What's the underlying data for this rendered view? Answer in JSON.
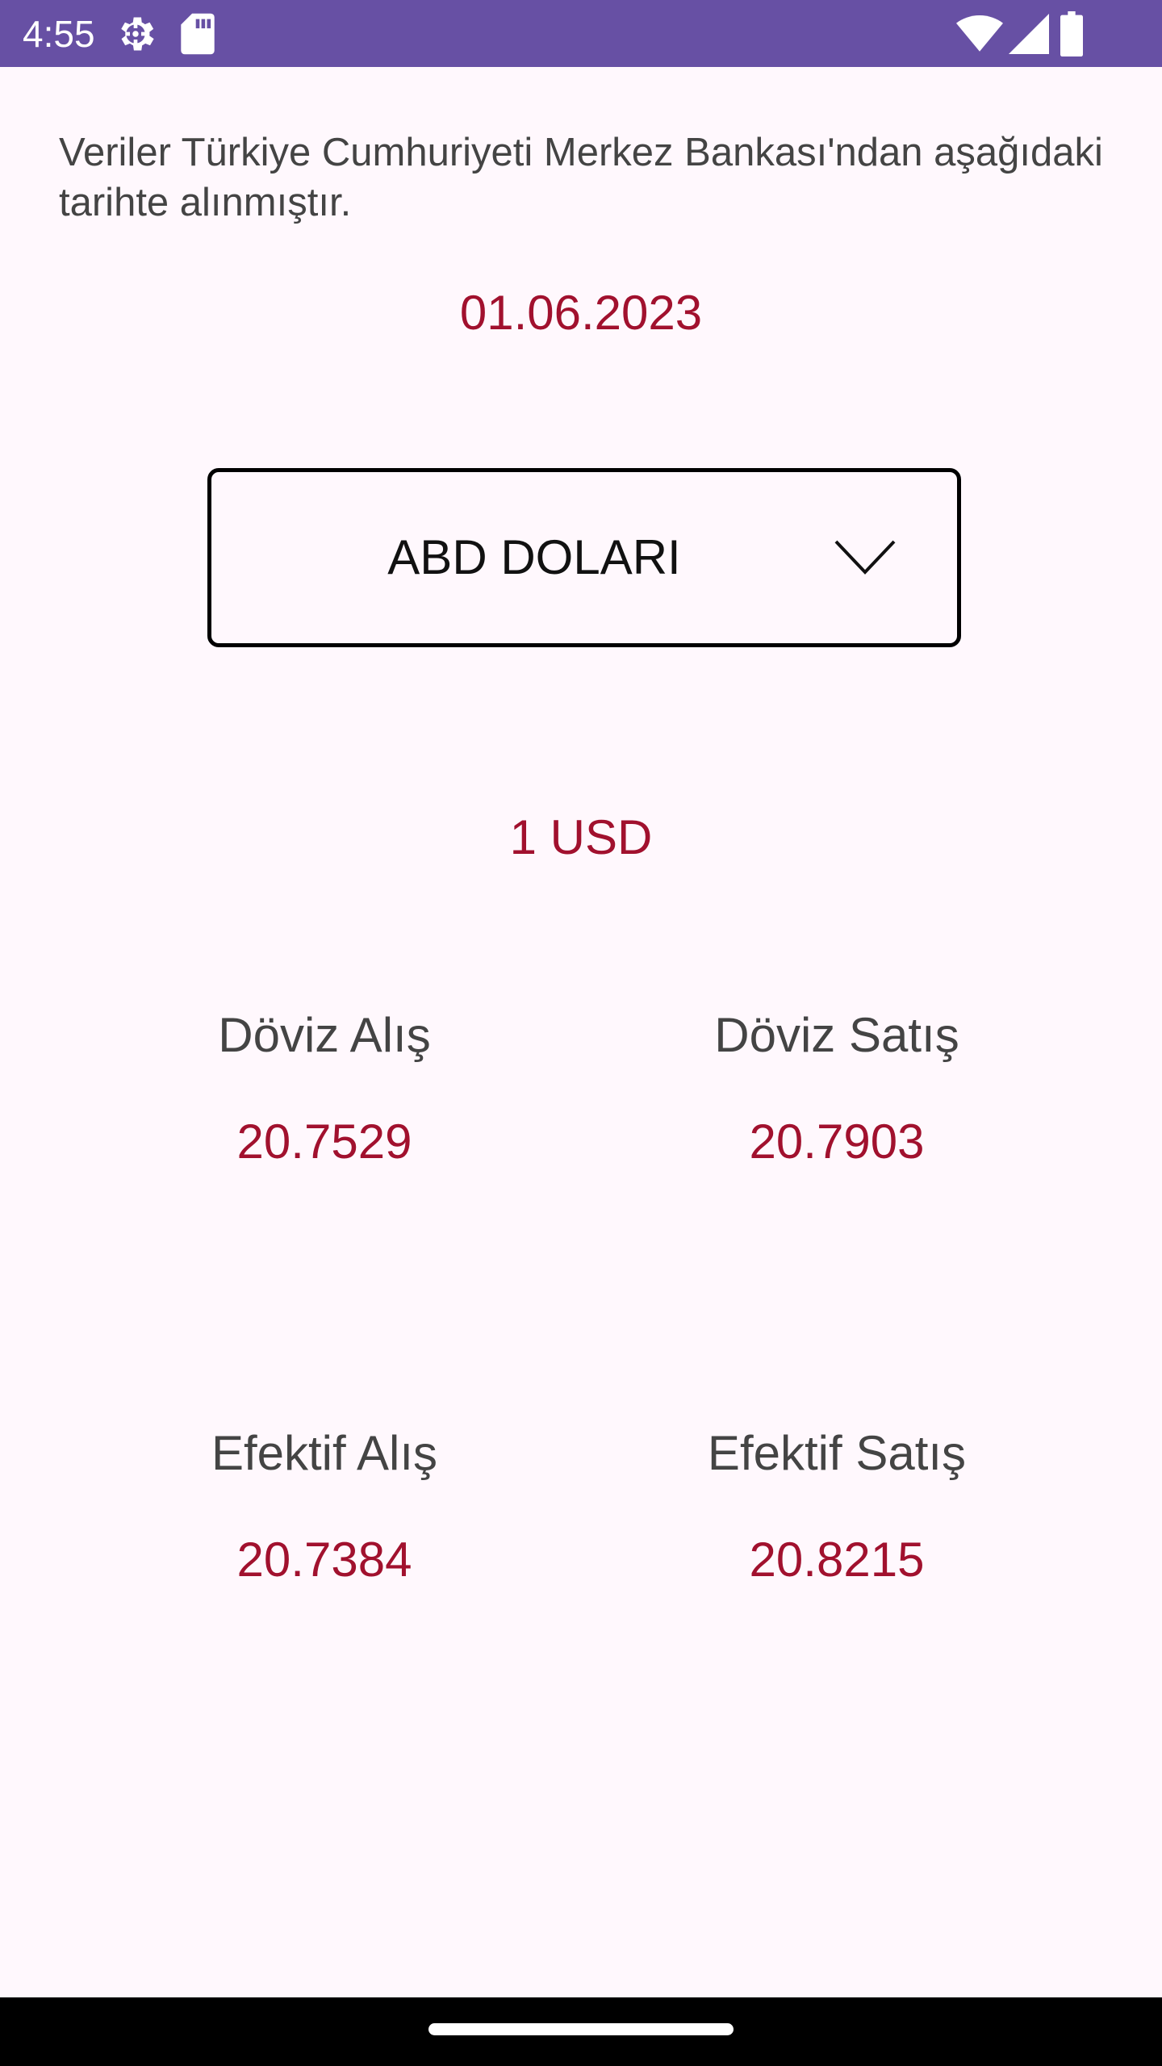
{
  "status_bar": {
    "time": "4:55",
    "background_color": "#6750A4",
    "icons": [
      "settings-icon",
      "sd-card-icon",
      "wifi-icon",
      "signal-icon",
      "battery-icon"
    ]
  },
  "intro_text": "Veriler Türkiye Cumhuriyeti Merkez Bankası'ndan aşağıdaki tarihte alınmıştır.",
  "date": "01.06.2023",
  "currency_select": {
    "selected": "ABD DOLARI",
    "icon": "chevron-down-icon"
  },
  "unit": "1 USD",
  "rates": {
    "forex_buy": {
      "label": "Döviz Alış",
      "value": "20.7529"
    },
    "forex_sell": {
      "label": "Döviz Satış",
      "value": "20.7903"
    },
    "banknote_buy": {
      "label": "Efektif Alış",
      "value": "20.7384"
    },
    "banknote_sell": {
      "label": "Efektif Satış",
      "value": "20.8215"
    }
  },
  "colors": {
    "accent": "#A1112E",
    "background": "#FFF8FD",
    "text": "#444444"
  }
}
